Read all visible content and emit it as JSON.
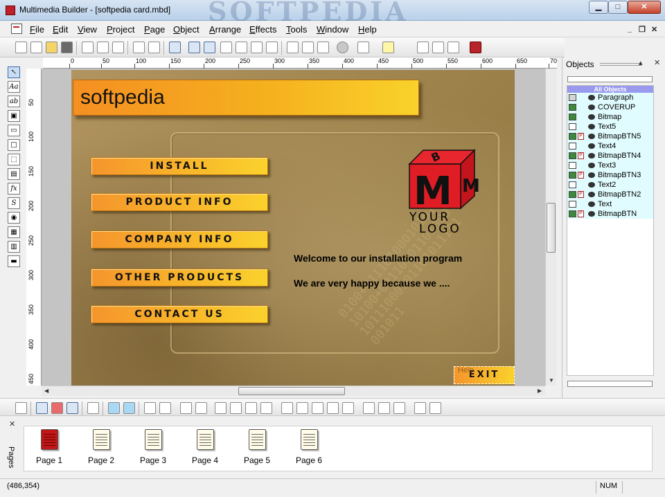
{
  "window": {
    "title": "Multimedia Builder - [softpedia card.mbd]",
    "watermark": "SOFTPEDIA",
    "min_label": "▁",
    "max_label": "□",
    "close_label": "✕"
  },
  "menu": {
    "items": [
      "File",
      "Edit",
      "View",
      "Project",
      "Page",
      "Object",
      "Arrange",
      "Effects",
      "Tools",
      "Window",
      "Help"
    ],
    "mdi_min": "_",
    "mdi_restore": "❐",
    "mdi_close": "✕"
  },
  "ruler": {
    "h_ticks": [
      "0",
      "50",
      "100",
      "150",
      "200",
      "250",
      "300",
      "350",
      "400",
      "450",
      "500",
      "550",
      "600",
      "650",
      "70"
    ],
    "v_ticks": [
      "50",
      "100",
      "150",
      "200",
      "250",
      "300",
      "350",
      "400",
      "450"
    ]
  },
  "card": {
    "header": "softpedia",
    "buttons": [
      "INSTALL",
      "PRODUCT INFO",
      "COMPANY INFO",
      "OTHER PRODUCTS",
      "CONTACT US"
    ],
    "exit_label": "EXIT",
    "exit_ghost": "Help",
    "welcome_line1": "Welcome to our installation program",
    "welcome_line2": "We are very happy because we ....",
    "logo_line1": "YOUR",
    "logo_line2": "LOGO",
    "logo_letters": [
      "B",
      "M",
      "M"
    ],
    "digits": "0100+01110100010101110100+0011010110100010111000101101011101001011",
    "colors": {
      "orange": "#f5952c",
      "yellow": "#fad22c",
      "logo_red": "#d61b23"
    }
  },
  "objects_panel": {
    "title": "Objects",
    "close": "✕",
    "pin": "▴",
    "header": "All Objects",
    "items": [
      {
        "name": "Paragraph",
        "icon": "paragraph-icon",
        "p": false
      },
      {
        "name": "COVERUP",
        "icon": "bitmap-icon",
        "p": false
      },
      {
        "name": "Bitmap",
        "icon": "bitmap-icon",
        "p": false
      },
      {
        "name": "Text5",
        "icon": "text-icon",
        "p": false
      },
      {
        "name": "BitmapBTN5",
        "icon": "bitmap-button-icon",
        "p": true
      },
      {
        "name": "Text4",
        "icon": "text-icon",
        "p": false
      },
      {
        "name": "BitmapBTN4",
        "icon": "bitmap-button-icon",
        "p": true
      },
      {
        "name": "Text3",
        "icon": "text-icon",
        "p": false
      },
      {
        "name": "BitmapBTN3",
        "icon": "bitmap-button-icon",
        "p": true
      },
      {
        "name": "Text2",
        "icon": "text-icon",
        "p": false
      },
      {
        "name": "BitmapBTN2",
        "icon": "bitmap-button-icon",
        "p": true
      },
      {
        "name": "Text",
        "icon": "text-icon",
        "p": false
      },
      {
        "name": "BitmapBTN",
        "icon": "bitmap-button-icon",
        "p": true
      }
    ]
  },
  "pages_panel": {
    "label": "Pages",
    "close": "✕",
    "pages": [
      "Page 1",
      "Page 2",
      "Page 3",
      "Page 4",
      "Page 5",
      "Page 6"
    ],
    "active_index": 0
  },
  "status": {
    "coords": "(486,354)",
    "num": "NUM"
  },
  "palette_tools": [
    "↖",
    "Aa",
    "ab",
    "▣",
    "▭",
    "□",
    "⬚",
    "▤",
    "fx",
    "S",
    "◉",
    "▦",
    "▥",
    "▬"
  ]
}
